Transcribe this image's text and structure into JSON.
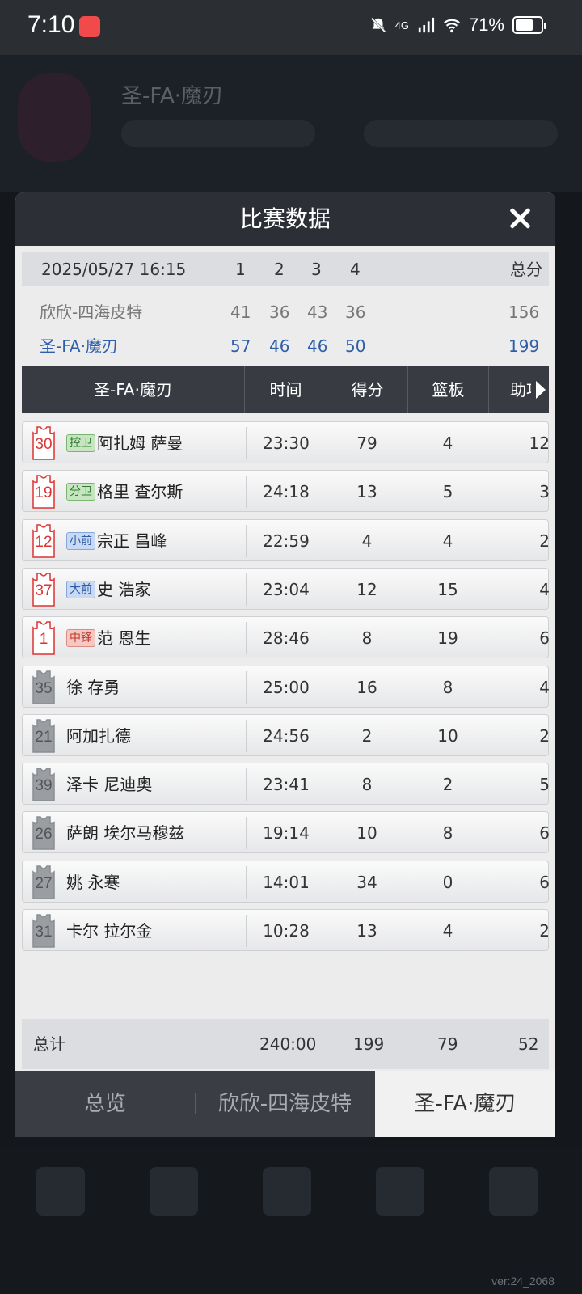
{
  "status_bar": {
    "time": "7:10",
    "network": "4G",
    "battery": "71%",
    "battery_level": 0.71,
    "icons": [
      "app-notification-icon",
      "mute-icon",
      "signal-icon",
      "wifi-icon",
      "battery-icon"
    ]
  },
  "modal": {
    "title": "比赛数据",
    "close_icon": "close-icon"
  },
  "quarter_scores": {
    "date": "2025/05/27 16:15",
    "quarters": [
      "1",
      "2",
      "3",
      "4"
    ],
    "total_label": "总分",
    "teams": [
      {
        "name": "欣欣-四海皮特",
        "q": [
          "41",
          "36",
          "43",
          "36"
        ],
        "total": "156",
        "color": "#777777"
      },
      {
        "name": "圣-FA·魔刃",
        "q": [
          "57",
          "46",
          "46",
          "50"
        ],
        "total": "199",
        "color": "#2f5ea8"
      }
    ]
  },
  "box_score": {
    "team": "圣-FA·魔刃",
    "columns": [
      "时间",
      "得分",
      "篮板",
      "助攻"
    ],
    "players": [
      {
        "number": "30",
        "starter": true,
        "position": "控卫",
        "pos_color": "green",
        "name": "阿扎姆 萨曼",
        "time": "23:30",
        "pts": "79",
        "reb": "4",
        "ast": "12"
      },
      {
        "number": "19",
        "starter": true,
        "position": "分卫",
        "pos_color": "green",
        "name": "格里 查尔斯",
        "time": "24:18",
        "pts": "13",
        "reb": "5",
        "ast": "3"
      },
      {
        "number": "12",
        "starter": true,
        "position": "小前",
        "pos_color": "blue",
        "name": "宗正 昌峰",
        "time": "22:59",
        "pts": "4",
        "reb": "4",
        "ast": "2"
      },
      {
        "number": "37",
        "starter": true,
        "position": "大前",
        "pos_color": "blue",
        "name": "史 浩家",
        "time": "23:04",
        "pts": "12",
        "reb": "15",
        "ast": "4"
      },
      {
        "number": "1",
        "starter": true,
        "position": "中锋",
        "pos_color": "red",
        "name": "范 恩生",
        "time": "28:46",
        "pts": "8",
        "reb": "19",
        "ast": "6"
      },
      {
        "number": "35",
        "starter": false,
        "position": "",
        "pos_color": "",
        "name": "徐 存勇",
        "time": "25:00",
        "pts": "16",
        "reb": "8",
        "ast": "4"
      },
      {
        "number": "21",
        "starter": false,
        "position": "",
        "pos_color": "",
        "name": "阿加扎德",
        "time": "24:56",
        "pts": "2",
        "reb": "10",
        "ast": "2"
      },
      {
        "number": "39",
        "starter": false,
        "position": "",
        "pos_color": "",
        "name": "泽卡 尼迪奥",
        "time": "23:41",
        "pts": "8",
        "reb": "2",
        "ast": "5"
      },
      {
        "number": "26",
        "starter": false,
        "position": "",
        "pos_color": "",
        "name": "萨朗 埃尔马穆兹",
        "time": "19:14",
        "pts": "10",
        "reb": "8",
        "ast": "6"
      },
      {
        "number": "27",
        "starter": false,
        "position": "",
        "pos_color": "",
        "name": "姚 永寒",
        "time": "14:01",
        "pts": "34",
        "reb": "0",
        "ast": "6"
      },
      {
        "number": "31",
        "starter": false,
        "position": "",
        "pos_color": "",
        "name": "卡尔 拉尔金",
        "time": "10:28",
        "pts": "13",
        "reb": "4",
        "ast": "2"
      }
    ],
    "totals": {
      "label": "总计",
      "time": "240:00",
      "pts": "199",
      "reb": "79",
      "ast": "52"
    }
  },
  "tabs": [
    "总览",
    "欣欣-四海皮特",
    "圣-FA·魔刃"
  ],
  "active_tab": 2,
  "background": {
    "team_name": "圣-FA·魔刃",
    "version": "ver:24_2068"
  }
}
